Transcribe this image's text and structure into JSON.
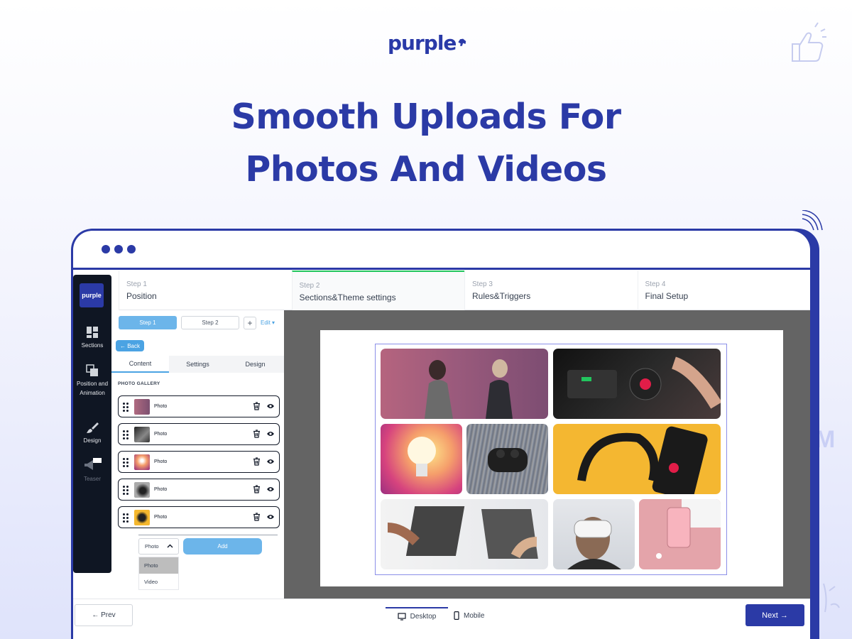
{
  "brand": {
    "logo_text": "purple",
    "accent": "#2b3aa6"
  },
  "headline": {
    "line1": "Smooth Uploads For",
    "line2": "Photos And Videos"
  },
  "rail": {
    "logo_text": "purple",
    "items": [
      {
        "label": "Sections",
        "icon": "sections-icon"
      },
      {
        "label": "Position and Animation",
        "icon": "position-icon"
      },
      {
        "label": "Design",
        "icon": "brush-icon"
      },
      {
        "label": "Teaser",
        "icon": "megaphone-icon"
      }
    ]
  },
  "steps": [
    {
      "num": "Step 1",
      "name": "Position"
    },
    {
      "num": "Step 2",
      "name": "Sections&Theme settings"
    },
    {
      "num": "Step 3",
      "name": "Rules&Triggers"
    },
    {
      "num": "Step 4",
      "name": "Final Setup"
    }
  ],
  "panel": {
    "step_tabs": [
      "Step 1",
      "Step 2"
    ],
    "plus": "+",
    "edit": "Edit ▾",
    "back": "← Back",
    "subtabs": [
      "Content",
      "Settings",
      "Design"
    ],
    "section_label": "PHOTO GALLERY",
    "rows": [
      {
        "label": "Photo"
      },
      {
        "label": "Photo"
      },
      {
        "label": "Photo"
      },
      {
        "label": "Photo"
      },
      {
        "label": "Photo"
      }
    ],
    "select_value": "Photo",
    "add_label": "Add",
    "options": [
      "Photo",
      "Video"
    ]
  },
  "bottom": {
    "prev": "← Prev",
    "desktop": "Desktop",
    "mobile": "Mobile",
    "next": "Next →"
  }
}
